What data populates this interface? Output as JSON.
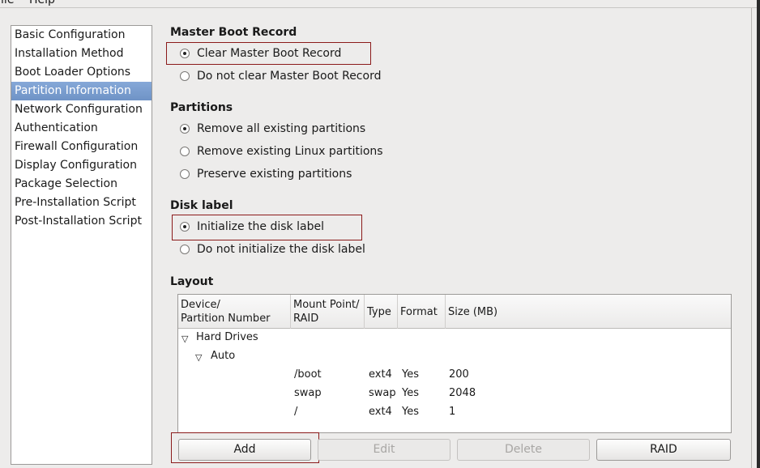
{
  "menu": [
    "File",
    "Help"
  ],
  "sidebar": {
    "items": [
      "Basic Configuration",
      "Installation Method",
      "Boot Loader Options",
      "Partition Information",
      "Network Configuration",
      "Authentication",
      "Firewall Configuration",
      "Display Configuration",
      "Package Selection",
      "Pre-Installation Script",
      "Post-Installation Script"
    ],
    "selected": "Partition Information"
  },
  "mbr": {
    "title": "Master Boot Record",
    "options": [
      "Clear Master Boot Record",
      "Do not clear Master Boot Record"
    ],
    "selected": 0
  },
  "partitions": {
    "title": "Partitions",
    "options": [
      "Remove all existing partitions",
      "Remove existing Linux partitions",
      "Preserve existing partitions"
    ],
    "selected": 0
  },
  "disklabel": {
    "title": "Disk label",
    "options": [
      "Initialize the disk label",
      "Do not initialize the disk label"
    ],
    "selected": 0
  },
  "layout": {
    "title": "Layout",
    "columns": [
      "Device/\nPartition Number",
      "Mount Point/\nRAID",
      "Type",
      "Format",
      "Size (MB)"
    ],
    "tree": {
      "root": "Hard Drives",
      "child": "Auto"
    },
    "rows": [
      {
        "mount": "/boot",
        "type": "ext4",
        "format": "Yes",
        "size": "200"
      },
      {
        "mount": "swap",
        "type": "swap",
        "format": "Yes",
        "size": "2048"
      },
      {
        "mount": "/",
        "type": "ext4",
        "format": "Yes",
        "size": "1"
      }
    ]
  },
  "buttons": {
    "add": "Add",
    "edit": "Edit",
    "delete": "Delete",
    "raid": "RAID"
  }
}
